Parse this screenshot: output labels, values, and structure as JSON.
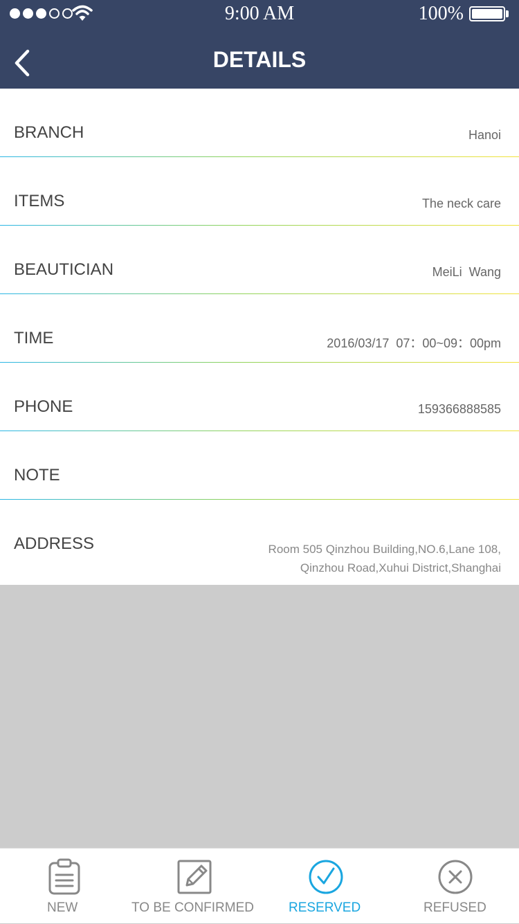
{
  "status_bar": {
    "time": "9:00 AM",
    "battery": "100%"
  },
  "header": {
    "title": "DETAILS"
  },
  "details": [
    {
      "label": "BRANCH",
      "value": "Hanoi"
    },
    {
      "label": "ITEMS",
      "value": "The neck care"
    },
    {
      "label": "BEAUTICIAN",
      "value": "MeiLi  Wang"
    },
    {
      "label": "TIME",
      "value": "2016/03/17  07：00~09：00pm"
    },
    {
      "label": "PHONE",
      "value": "159366888585"
    },
    {
      "label": "NOTE",
      "value": ""
    },
    {
      "label": "ADDRESS",
      "value_lines": [
        "Room 505 Qinzhou Building,NO.6,Lane 108,",
        "Qinzhou Road,Xuhui District,Shanghai"
      ]
    }
  ],
  "tabs": [
    {
      "label": "NEW",
      "icon": "clipboard-icon",
      "active": false
    },
    {
      "label": "TO BE CONFIRMED",
      "icon": "edit-icon",
      "active": false
    },
    {
      "label": "RESERVED",
      "icon": "check-circle-icon",
      "active": true
    },
    {
      "label": "REFUSED",
      "icon": "x-circle-icon",
      "active": false
    }
  ],
  "colors": {
    "header_bg": "#374565",
    "active_tab": "#1aa6e0",
    "inactive_tab": "#888888",
    "empty_area": "#cccccc"
  }
}
